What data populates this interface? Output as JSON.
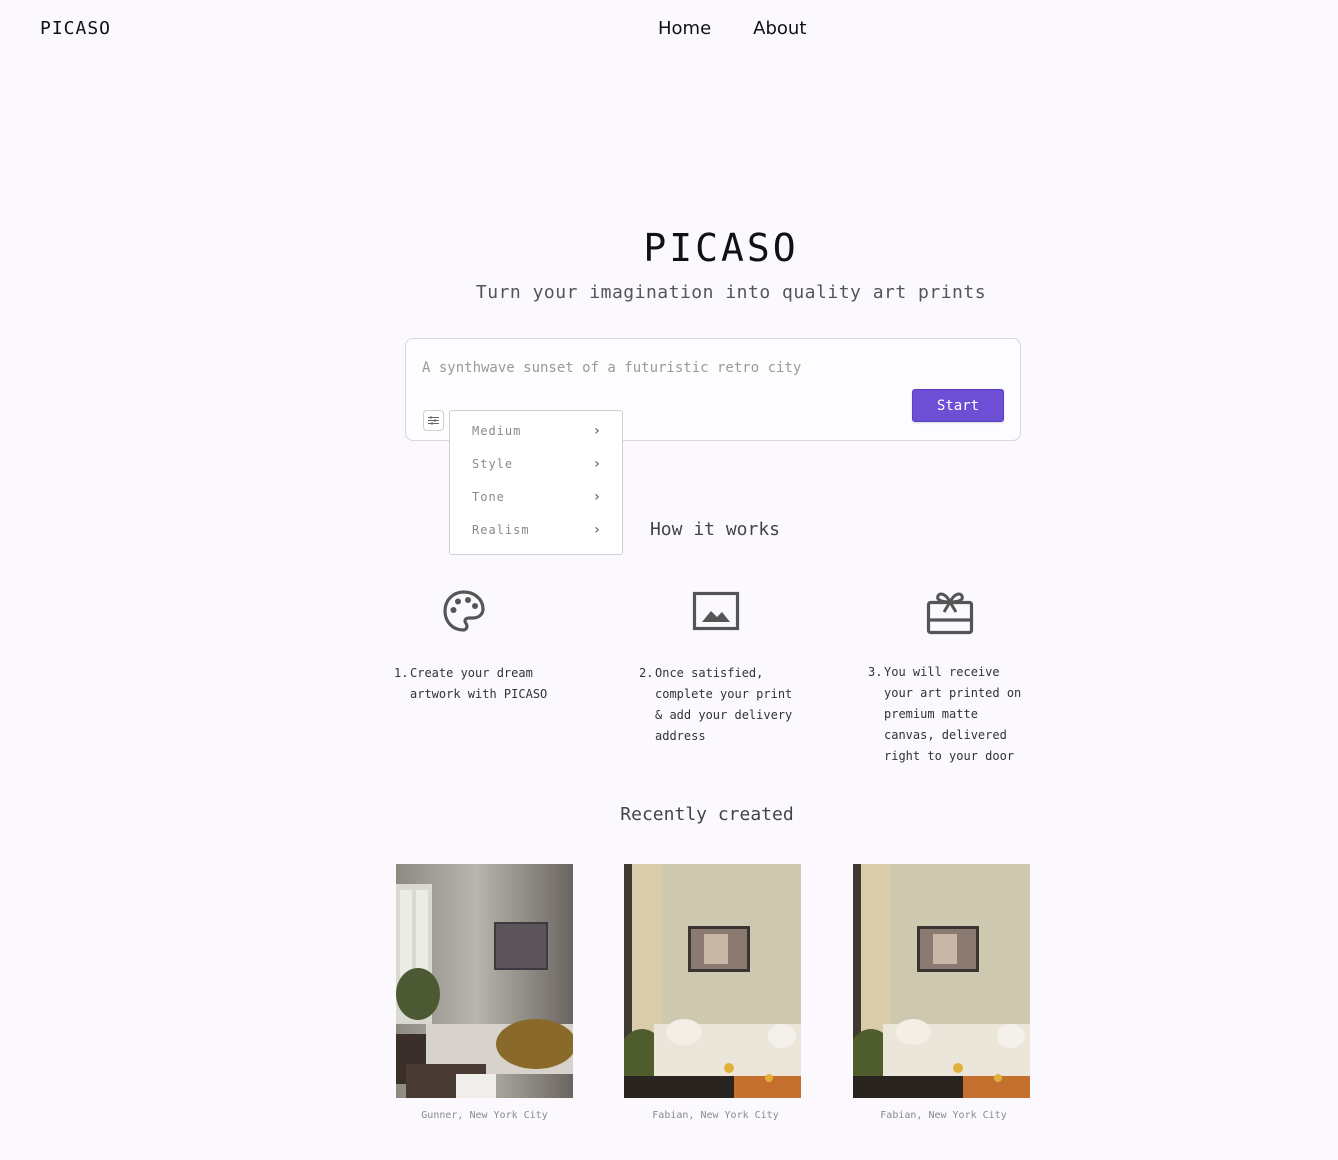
{
  "header": {
    "logo": "PICASO",
    "nav": [
      "Home",
      "About"
    ]
  },
  "hero": {
    "title": "PICASO",
    "subtitle": "Turn your imagination into quality art prints"
  },
  "prompt": {
    "placeholder": "A synthwave sunset of a futuristic retro city",
    "start_label": "Start",
    "options_icon": "sliders-icon"
  },
  "options_menu": {
    "items": [
      "Medium",
      "Style",
      "Tone",
      "Realism"
    ],
    "chevron_icon": "chevron-right-icon"
  },
  "how_it_works": {
    "title": "How it works",
    "steps": [
      {
        "num": "1.",
        "icon": "palette-icon",
        "text": "Create your dream artwork with PICASO"
      },
      {
        "num": "2.",
        "icon": "image-icon",
        "text": "Once satisfied, complete your print & add your delivery address"
      },
      {
        "num": "3.",
        "icon": "gift-card-icon",
        "text": "You will receive your art printed on premium matte canvas, delivered right to your door"
      }
    ]
  },
  "recently_created": {
    "title": "Recently created",
    "items": [
      {
        "caption": "Gunner, New York City"
      },
      {
        "caption": "Fabian, New York City"
      },
      {
        "caption": "Fabian, New York City"
      }
    ]
  },
  "colors": {
    "accent": "#6d4fd6",
    "background": "#fbf9fd"
  }
}
